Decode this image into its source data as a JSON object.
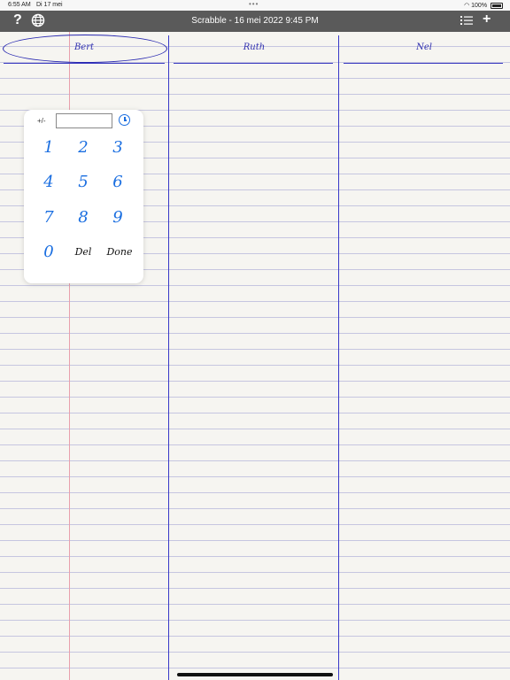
{
  "status": {
    "time": "6:55 AM",
    "date": "Di 17 mei",
    "battery": "100%"
  },
  "toolbar": {
    "title": "Scrabble - 16 mei 2022 9:45 PM",
    "help_icon": "?",
    "globe_icon": "globe-icon",
    "list_icon": "list-icon",
    "add_icon": "+"
  },
  "players": [
    {
      "name": "Bert"
    },
    {
      "name": "Ruth"
    },
    {
      "name": "Nel"
    }
  ],
  "keypad": {
    "plusminus": "+/-",
    "entry_value": "",
    "keys": [
      "1",
      "2",
      "3",
      "4",
      "5",
      "6",
      "7",
      "8",
      "9",
      "0",
      "Del",
      "Done"
    ]
  },
  "colors": {
    "ink": "#3030b0",
    "accent": "#1a6ee0",
    "margin": "#e8a0ac"
  }
}
